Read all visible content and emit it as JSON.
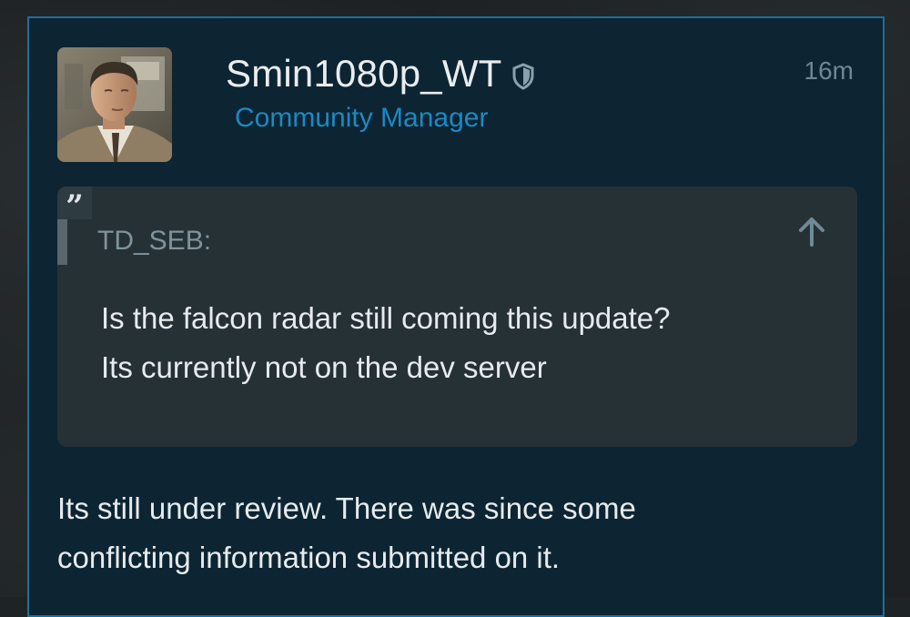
{
  "post": {
    "username": "Smin1080p_WT",
    "role": "Community Manager",
    "time": "16m",
    "badge_icon": "shield-icon",
    "quote": {
      "icon": "quote-icon",
      "author": "TD_SEB:",
      "lines": [
        "Is the falcon radar still coming this update?",
        "Its currently not on the dev server"
      ],
      "expand_icon": "arrow-up-icon"
    },
    "reply_lines": [
      "Its still under review. There was since some",
      "conflicting information submitted on it."
    ]
  },
  "colors": {
    "card_bg": "#0d2433",
    "card_border": "#1f6f99",
    "role_accent": "#1c89c2",
    "quote_bg": "#263136"
  }
}
